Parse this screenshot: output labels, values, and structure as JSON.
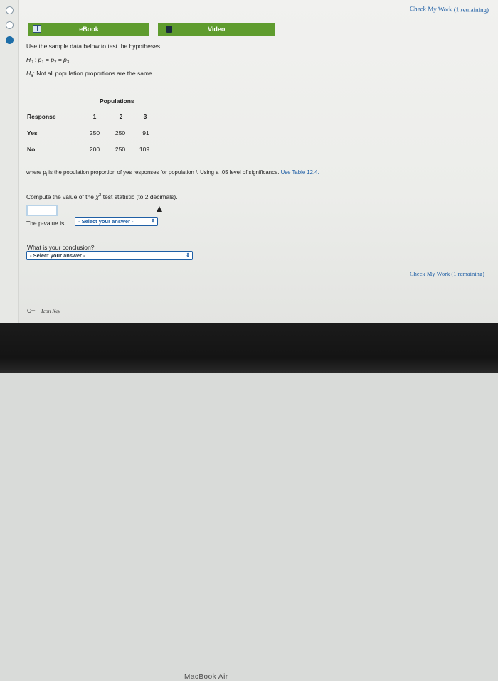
{
  "header": {
    "check_work_top": "Check My Work (1 remaining)",
    "check_work_bottom": "Check My Work (1 remaining)",
    "ebook_label": "eBook",
    "video_label": "Video"
  },
  "question": {
    "intro": "Use the sample data below to test the hypotheses",
    "h0_prefix": "H",
    "h0_sub": "0",
    "h0_text": ": p",
    "h0_eq": "p1 = p2 = p3",
    "ha_prefix": "H",
    "ha_sub": "a",
    "ha_text": ": Not all population proportions are the same",
    "table": {
      "title": "Populations",
      "header_label": "Response",
      "columns": [
        "1",
        "2",
        "3"
      ],
      "rows": [
        {
          "label": "Yes",
          "values": [
            "250",
            "250",
            "91"
          ]
        },
        {
          "label": "No",
          "values": [
            "200",
            "250",
            "109"
          ]
        }
      ]
    },
    "where_text": "where p",
    "where_sub": "i",
    "where_rest": " is the population proportion of yes responses for population ",
    "where_i": "i",
    "where_tail": ". Using a .05 level of significance. ",
    "table_ref": "Use Table 12.4.",
    "compute_prefix": "Compute the value of the ",
    "chi": "χ",
    "chi_sup": "2",
    "compute_suffix": " test statistic (to 2 decimals).",
    "pvalue_label": "The p-value is",
    "pvalue_select": "- Select your answer -",
    "conclusion_label": "What is your conclusion?",
    "conclusion_select": "- Select your answer -"
  },
  "footer": {
    "icon_key": "Icon Key",
    "device_label": "MacBook Air"
  },
  "colors": {
    "accent_green": "#5f9c2e",
    "link_blue": "#1f5fa5"
  }
}
